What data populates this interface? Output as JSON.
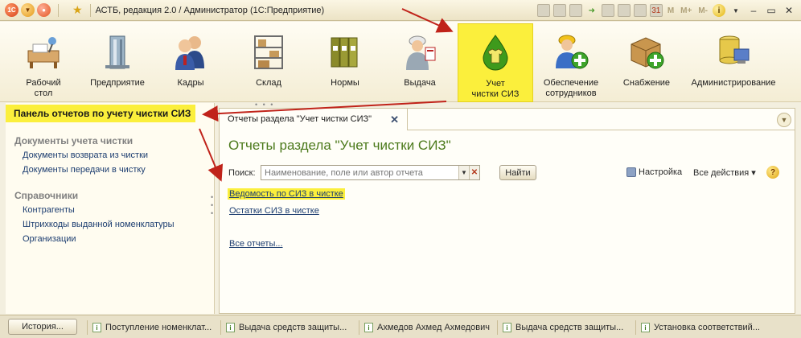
{
  "titlebar": {
    "title": "АСТБ, редакция 2.0 / Администратор  (1С:Предприятие)",
    "tools": [
      "M",
      "M+",
      "M-"
    ]
  },
  "sections": [
    {
      "label_line1": "Рабочий",
      "label_line2": "стол",
      "icon": "desktop-icon"
    },
    {
      "label_line1": "Предприятие",
      "label_line2": "",
      "icon": "building-icon"
    },
    {
      "label_line1": "Кадры",
      "label_line2": "",
      "icon": "people-icon"
    },
    {
      "label_line1": "Склад",
      "label_line2": "",
      "icon": "warehouse-icon"
    },
    {
      "label_line1": "Нормы",
      "label_line2": "",
      "icon": "binders-icon"
    },
    {
      "label_line1": "Выдача",
      "label_line2": "",
      "icon": "worker-icon"
    },
    {
      "label_line1": "Учет",
      "label_line2": "чистки СИЗ",
      "icon": "drop-shirt-icon"
    },
    {
      "label_line1": "Обеспечение",
      "label_line2": "сотрудников",
      "icon": "worker-add-icon"
    },
    {
      "label_line1": "Снабжение",
      "label_line2": "",
      "icon": "box-add-icon"
    },
    {
      "label_line1": "Администрирование",
      "label_line2": "",
      "icon": "admin-icon"
    }
  ],
  "left_panel": {
    "header": "Панель отчетов по учету чистки СИЗ",
    "group1": "Документы учета чистки",
    "group1_items": [
      "Документы возврата из чистки",
      "Документы передачи в чистку"
    ],
    "group2": "Справочники",
    "group2_items": [
      "Контрагенты",
      "Штрихкоды выданной номенклатуры",
      "Организации"
    ]
  },
  "tab": {
    "label": "Отчеты раздела \"Учет чистки СИЗ\"",
    "close": "✕"
  },
  "form": {
    "title": "Отчеты раздела \"Учет чистки СИЗ\"",
    "search_label": "Поиск:",
    "search_placeholder": "Наименование, поле или автор отчета",
    "find_button": "Найти",
    "settings": "Настройка",
    "all_actions": "Все действия",
    "help": "?",
    "reports": [
      "Ведомость по СИЗ в чистке",
      "Остатки СИЗ в чистке"
    ],
    "all_reports": "Все отчеты..."
  },
  "taskbar": {
    "history_button": "История...",
    "items": [
      "Поступление номенклат...",
      "Выдача средств защиты...",
      "Ахмедов Ахмед Ахмедович",
      "Выдача средств защиты...",
      "Установка соответствий..."
    ]
  },
  "colors": {
    "highlight": "#fbef3c",
    "accent_green": "#4c7a1c",
    "annotation_arrow": "#c0231a"
  }
}
